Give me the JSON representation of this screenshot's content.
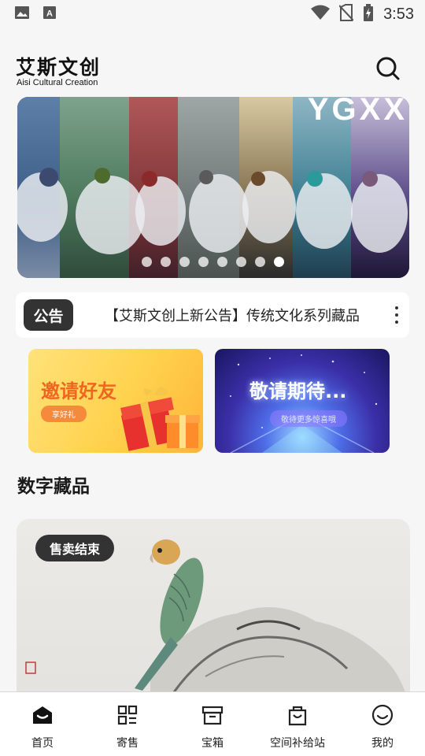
{
  "status": {
    "time": "3:53"
  },
  "header": {
    "logo_cn": "艾斯文创",
    "logo_en": "Aisi Cultural Creation"
  },
  "banner": {
    "text": "YGXX",
    "slide_count": 8,
    "active_slide": 7
  },
  "notice": {
    "badge": "公告",
    "text": "【艾斯文创上新公告】传统文化系列藏品"
  },
  "promos": {
    "invite_title": "邀请好友",
    "invite_sub": "享好礼",
    "expect_title": "敬请期待...",
    "expect_sub": "敬待更多惊喜哦"
  },
  "section": {
    "title": "数字藏品"
  },
  "card": {
    "status_badge": "售卖结束"
  },
  "tabs": [
    {
      "label": "首页",
      "icon": "home-icon",
      "active": true
    },
    {
      "label": "寄售",
      "icon": "grid-icon",
      "active": false
    },
    {
      "label": "宝箱",
      "icon": "box-icon",
      "active": false
    },
    {
      "label": "空间补给站",
      "icon": "bag-icon",
      "active": false
    },
    {
      "label": "我的",
      "icon": "smile-icon",
      "active": false
    }
  ],
  "colors": {
    "accent": "#333333",
    "background": "#f6f6f6",
    "invite_title": "#f06520"
  }
}
